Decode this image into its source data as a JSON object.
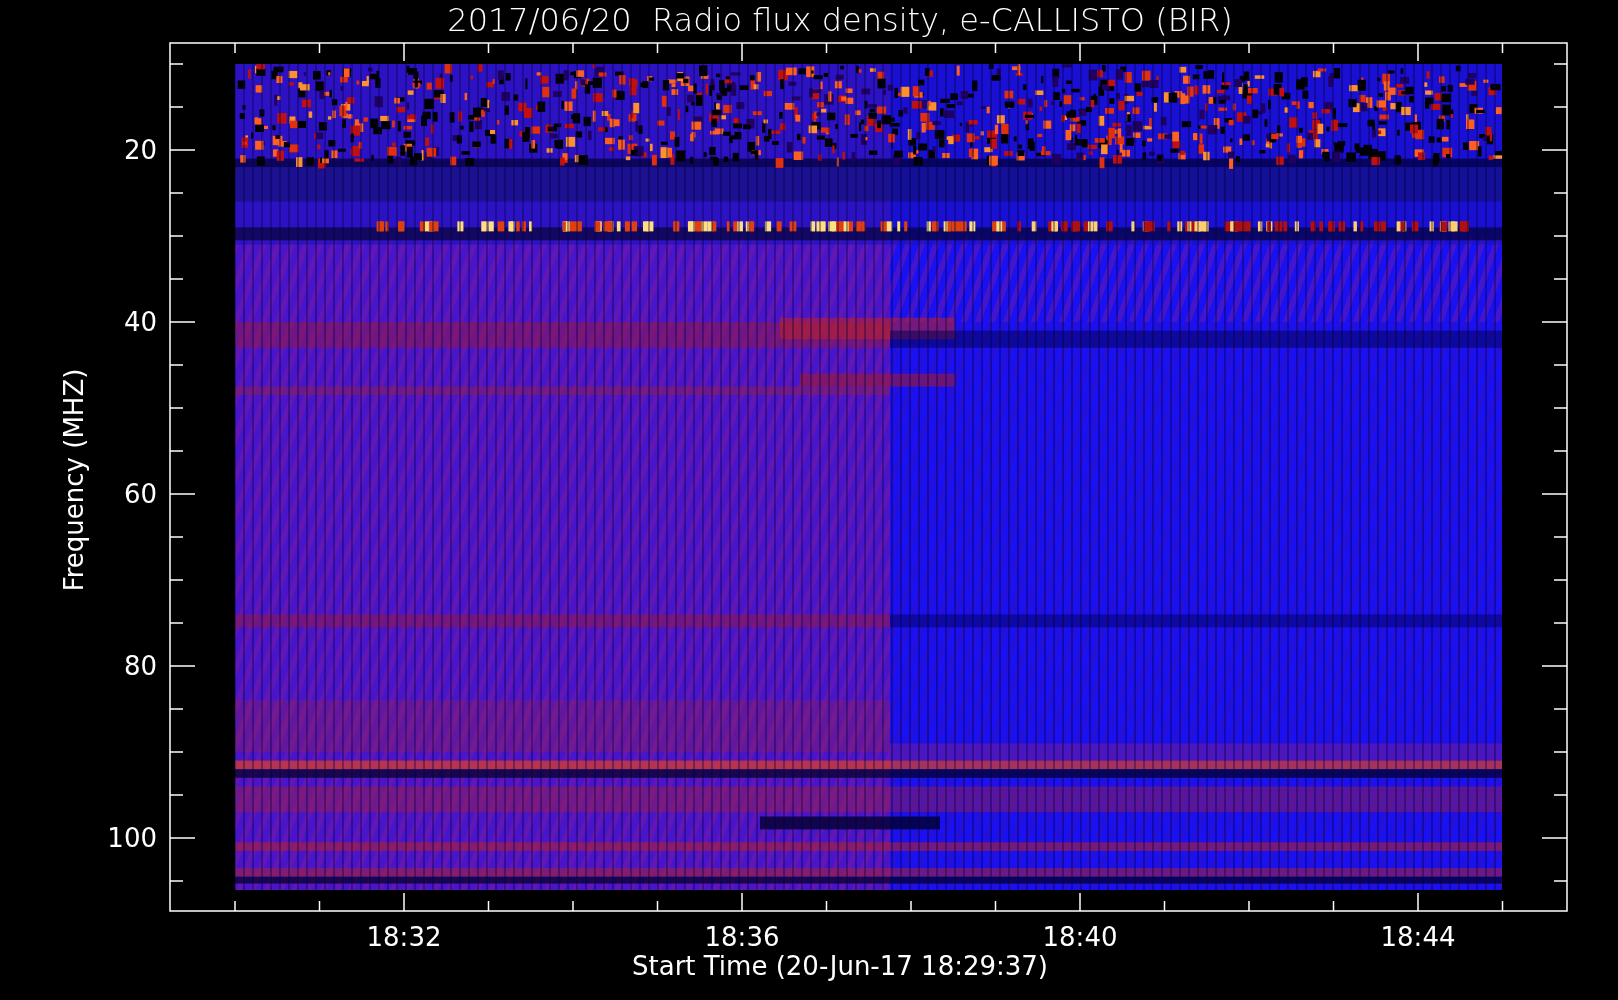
{
  "title": "2017/06/20  Radio flux density, e-CALLISTO (BIR)",
  "y_axis": {
    "label": "Frequency (MHZ)",
    "ticks": [
      "20",
      "40",
      "60",
      "80",
      "100"
    ]
  },
  "x_axis": {
    "label": "Start Time (20-Jun-17 18:29:37)",
    "ticks": [
      "18:32",
      "18:36",
      "18:40",
      "18:44"
    ]
  }
}
